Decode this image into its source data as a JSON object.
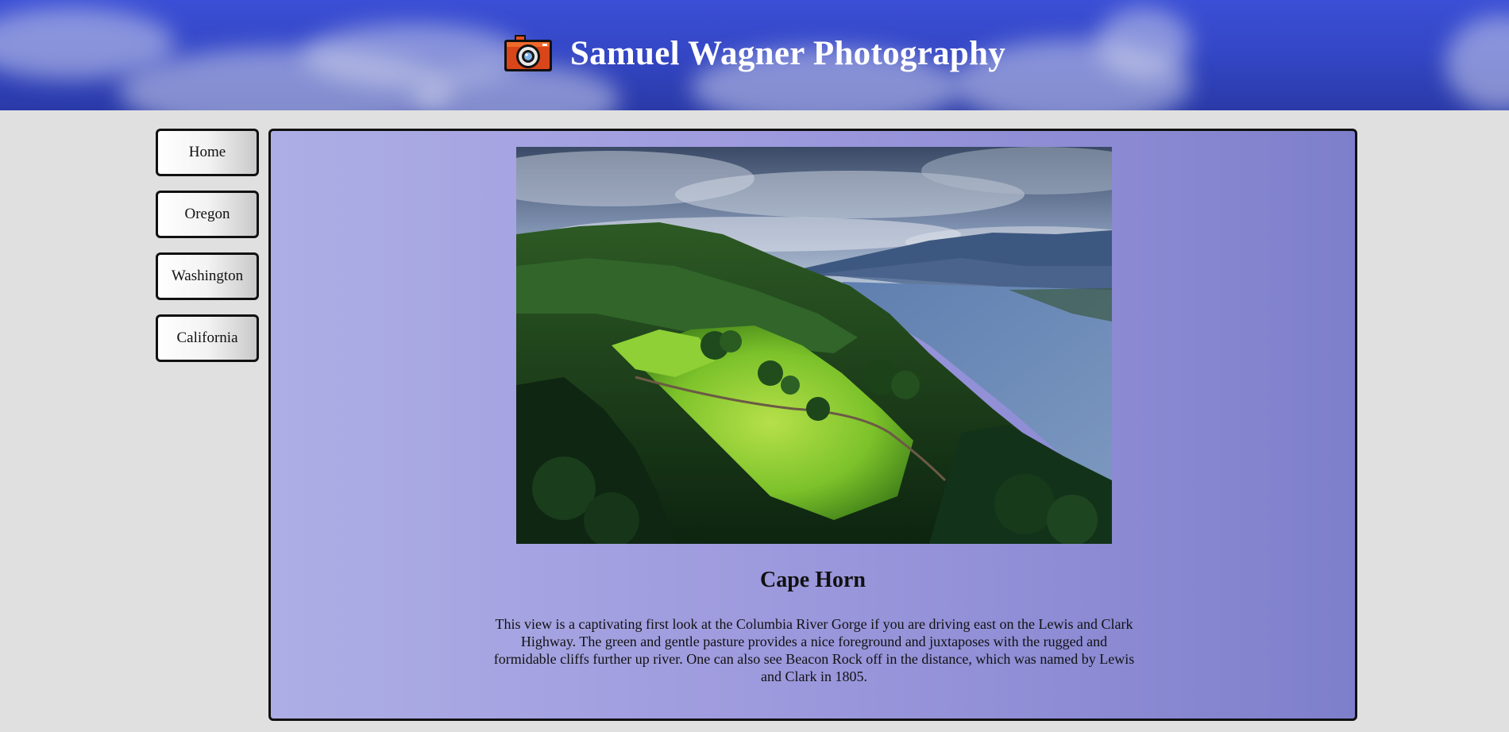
{
  "header": {
    "site_title": "Samuel Wagner Photography",
    "logo_icon": "camera-icon",
    "bg_color": "#3447c7"
  },
  "sidebar": {
    "items": [
      {
        "label": "Home"
      },
      {
        "label": "Oregon"
      },
      {
        "label": "Washington"
      },
      {
        "label": "California"
      }
    ]
  },
  "main": {
    "photo": {
      "subject": "Columbia River Gorge landscape with green pasture, forest and river"
    },
    "title": "Cape Horn",
    "description": "This view is a captivating first look at the Columbia River Gorge if you are driving east on the Lewis and Clark Highway. The green and gentle pasture provides a nice foreground and juxtaposes with the rugged and formidable cliffs further up river. One can also see Beacon Rock off in the distance, which was named by Lewis and Clark in 1805."
  },
  "colors": {
    "page_bg": "#e0e0e0",
    "panel_bg_start": "#adaee5",
    "panel_bg_end": "#7e7fcb",
    "border": "#111111"
  }
}
